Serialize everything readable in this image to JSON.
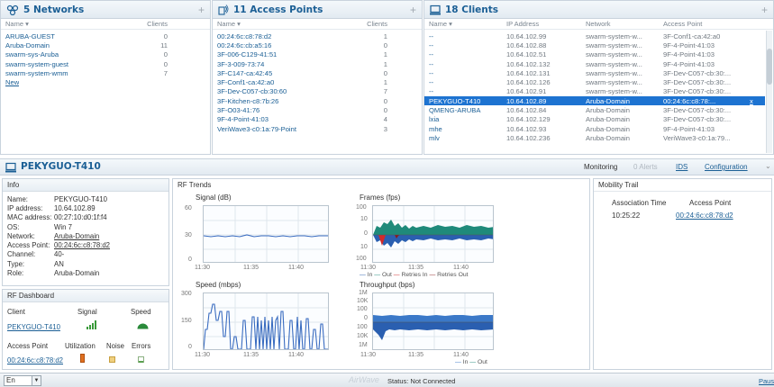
{
  "networks": {
    "title": "5 Networks",
    "col_name": "Name",
    "col_clients": "Clients",
    "rows": [
      {
        "name": "ARUBA-GUEST",
        "clients": "0"
      },
      {
        "name": "Aruba-Domain",
        "clients": "11"
      },
      {
        "name": "swarm-sys-Aruba",
        "clients": "0"
      },
      {
        "name": "swarm-system-guest",
        "clients": "0"
      },
      {
        "name": "swarm-system-wmm",
        "clients": "7"
      }
    ],
    "new_label": "New"
  },
  "access_points": {
    "title": "11 Access Points",
    "col_name": "Name",
    "col_clients": "Clients",
    "rows": [
      {
        "name": "00:24:6c:c8:78:d2",
        "clients": "1"
      },
      {
        "name": "00:24:6c:cb:a5:16",
        "clients": "0"
      },
      {
        "name": "3F-006-C129-41:51",
        "clients": "1"
      },
      {
        "name": "3F-3-009-73:74",
        "clients": "1"
      },
      {
        "name": "3F-C147-ca:42:45",
        "clients": "0"
      },
      {
        "name": "3F-Conf1-ca:42:a0",
        "clients": "1"
      },
      {
        "name": "3F-Dev-C057-cb:30:60",
        "clients": "7"
      },
      {
        "name": "3F-Kitchen-c8:7b:26",
        "clients": "0"
      },
      {
        "name": "3F-O03-41:76",
        "clients": "0"
      },
      {
        "name": "9F-4-Point-41:03",
        "clients": "4"
      },
      {
        "name": "VeriWave3-c0:1a:79-Point",
        "clients": "3"
      }
    ]
  },
  "clients": {
    "title": "18 Clients",
    "col_name": "Name",
    "col_ip": "IP Address",
    "col_network": "Network",
    "col_ap": "Access Point",
    "rows": [
      {
        "name": "--",
        "ip": "10.64.102.99",
        "network": "swarm-system-w...",
        "ap": "3F-Conf1-ca:42:a0"
      },
      {
        "name": "--",
        "ip": "10.64.102.88",
        "network": "swarm-system-w...",
        "ap": "9F-4-Point-41:03"
      },
      {
        "name": "--",
        "ip": "10.64.102.51",
        "network": "swarm-system-w...",
        "ap": "9F-4-Point-41:03"
      },
      {
        "name": "--",
        "ip": "10.64.102.132",
        "network": "swarm-system-w...",
        "ap": "9F-4-Point-41:03"
      },
      {
        "name": "--",
        "ip": "10.64.102.131",
        "network": "swarm-system-w...",
        "ap": "3F-Dev-C057-cb:30:..."
      },
      {
        "name": "--",
        "ip": "10.64.102.126",
        "network": "swarm-system-w...",
        "ap": "3F-Dev-C057-cb:30:..."
      },
      {
        "name": "--",
        "ip": "10.64.102.91",
        "network": "swarm-system-w...",
        "ap": "3F-Dev-C057-cb:30:..."
      },
      {
        "name": "PEKYGUO-T410",
        "ip": "10.64.102.89",
        "network": "Aruba-Domain",
        "ap": "00:24:6c:c8:78:...",
        "selected": true
      },
      {
        "name": "QMENG-ARUBA",
        "ip": "10.64.102.84",
        "network": "Aruba-Domain",
        "ap": "3F-Dev-C057-cb:30:..."
      },
      {
        "name": "lxia",
        "ip": "10.64.102.129",
        "network": "Aruba-Domain",
        "ap": "3F-Dev-C057-cb:30:..."
      },
      {
        "name": "mhe",
        "ip": "10.64.102.93",
        "network": "Aruba-Domain",
        "ap": "9F-4-Point-41:03"
      },
      {
        "name": "mlv",
        "ip": "10.64.102.236",
        "network": "Aruba-Domain",
        "ap": "VeriWave3-c0:1a:79..."
      }
    ],
    "selected_close": "x"
  },
  "client_detail": {
    "title": "PEKYGUO-T410",
    "monitoring": "Monitoring",
    "alerts": "0 Alerts",
    "ids": "IDS",
    "configuration": "Configuration"
  },
  "info": {
    "header": "Info",
    "name_label": "Name:",
    "name": "PEKYGUO-T410",
    "ip_label": "IP address:",
    "ip": "10.64.102.89",
    "mac_label": "MAC address:",
    "mac": "00:27:10:d0:1f:f4",
    "os_label": "OS:",
    "os": "Win 7",
    "network_label": "Network:",
    "network": "Aruba-Domain",
    "ap_label": "Access Point:",
    "ap": "00:24:6c:c8:78:d2",
    "channel_label": "Channel:",
    "channel": "40-",
    "type_label": "Type:",
    "type": "AN",
    "role_label": "Role:",
    "role": "Aruba-Domain"
  },
  "rf_dashboard": {
    "header": "RF Dashboard",
    "client_col": "Client",
    "signal_col": "Signal",
    "speed_col": "Speed",
    "client_name": "PEKYGUO-T410",
    "ap_col": "Access Point",
    "util_col": "Utilization",
    "noise_col": "Noise",
    "errors_col": "Errors",
    "ap_name": "00:24:6c:c8:78:d2"
  },
  "rf_trends": {
    "header": "RF Trends",
    "signal_title": "Signal  (dB)",
    "frames_title": "Frames  (fps)",
    "speed_title": "Speed  (mbps)",
    "throughput_title": "Throughput  (bps)",
    "x_ticks": [
      "11:30",
      "11:35",
      "11:40"
    ],
    "signal_y": [
      "60",
      "30",
      "0"
    ],
    "frames_y": [
      "100",
      "10",
      "0",
      "10",
      "100"
    ],
    "speed_y": [
      "300",
      "150",
      "0"
    ],
    "throughput_y": [
      "1M",
      "10K",
      "100",
      "0",
      "100",
      "10K",
      "1M"
    ],
    "frames_legend": [
      "In",
      "Out",
      "Retries In",
      "Retries Out"
    ],
    "throughput_legend": [
      "In",
      "Out"
    ]
  },
  "mobility": {
    "header": "Mobility Trail",
    "col_time": "Association Time",
    "col_ap": "Access Point",
    "time": "10:25:22",
    "ap": "00:24:6c:c8:78:d2"
  },
  "status_bar": {
    "lang": "En",
    "brand": "AirWave",
    "status": "Status: Not Connected",
    "pause": "Paus"
  },
  "colors": {
    "accent": "#1b5f95",
    "selected_row": "#1d73d1",
    "frames_in": "#1f8a7a",
    "frames_out": "#2a5fb0",
    "retries_in": "#d12a2a",
    "retries_out": "#8a1a1a"
  }
}
